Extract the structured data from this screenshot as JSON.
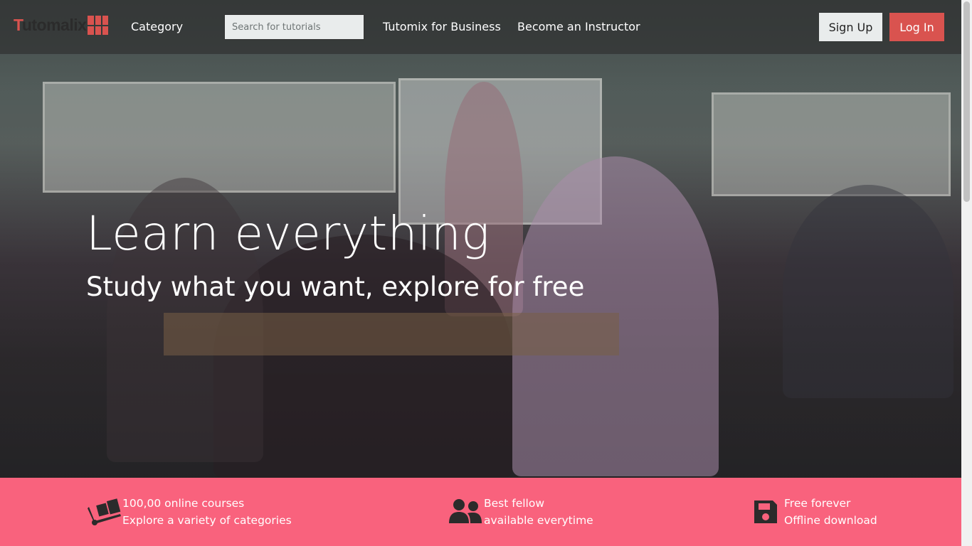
{
  "brand": {
    "logo_first_letter": "T",
    "logo_rest": "utomalix",
    "accent_color": "#d9534f"
  },
  "navbar": {
    "category_label": "Category",
    "search_placeholder": "Search for tutorials",
    "business_label": "Tutomix for Business",
    "instructor_label": "Become an Instructor",
    "signup_label": "Sign Up",
    "login_label": "Log In"
  },
  "hero": {
    "title": "Learn everything",
    "subtitle": "Study what you want, explore for free"
  },
  "features": {
    "band_color": "#f9627d",
    "items": [
      {
        "icon": "dolly-boxes-icon",
        "line1": "100,00 online courses",
        "line2": "Explore a variety of categories"
      },
      {
        "icon": "users-icon",
        "line1": "Best fellow",
        "line2": "available everytime"
      },
      {
        "icon": "floppy-disk-icon",
        "line1": "Free forever",
        "line2": "Offline download"
      }
    ]
  }
}
